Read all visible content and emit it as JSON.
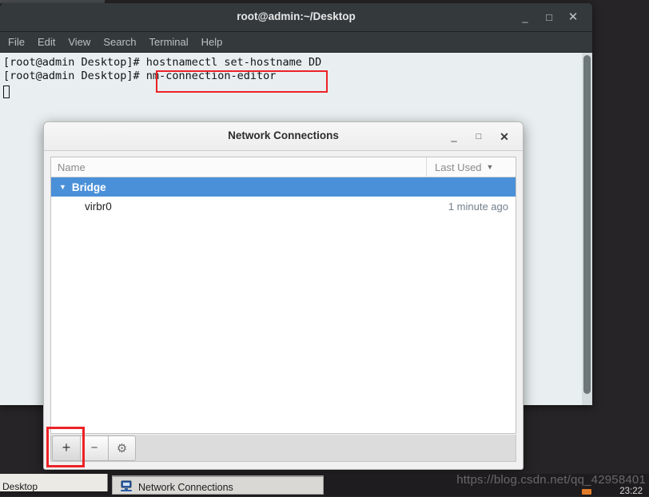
{
  "desktop": {
    "background_color": "#262426"
  },
  "terminal": {
    "title": "root@admin:~/Desktop",
    "controls": {
      "minimize": "_",
      "maximize": "□",
      "close": "✕"
    },
    "menu": [
      "File",
      "Edit",
      "View",
      "Search",
      "Terminal",
      "Help"
    ],
    "lines": [
      "[root@admin Desktop]# hostnamectl set-hostname DD",
      "[root@admin Desktop]# nm-connection-editor"
    ],
    "highlighted_command": "nm-connection-editor",
    "annotation_color": "#ec2227"
  },
  "dialog": {
    "title": "Network Connections",
    "controls": {
      "minimize": "_",
      "maximize": "□",
      "close": "✕"
    },
    "columns": {
      "name": "Name",
      "last_used": "Last Used",
      "sort_caret": "▼"
    },
    "groups": [
      {
        "label": "Bridge",
        "expander": "▼",
        "selected": true,
        "items": [
          {
            "name": "virbr0",
            "last_used": "1 minute ago"
          }
        ]
      }
    ],
    "toolbar": {
      "add_label": "+",
      "remove_label": "−",
      "settings_label": "⚙"
    },
    "selection_color": "#4a90d9"
  },
  "taskbar": {
    "desktop_label": "Desktop",
    "tasks": [
      {
        "label": "Network Connections",
        "icon": "network-icon"
      }
    ],
    "clock": "23:22"
  },
  "watermark": {
    "text": "https://blog.csdn.net/qq_42958401"
  }
}
